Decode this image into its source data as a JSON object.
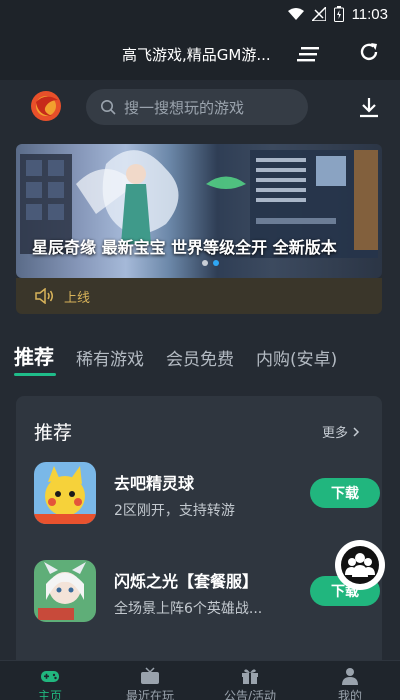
{
  "status_bar": {
    "time": "11:03"
  },
  "title_bar": {
    "title": "高飞游戏,精品GM游..."
  },
  "search": {
    "placeholder": "搜一搜想玩的游戏"
  },
  "banner": {
    "caption": "星辰奇缘 最新宝宝 世界等级全开 全新版本",
    "dot_count": 2,
    "active_dot": 2
  },
  "notice": {
    "text": "上线"
  },
  "tabs": [
    {
      "label": "推荐",
      "active": true
    },
    {
      "label": "稀有游戏",
      "active": false
    },
    {
      "label": "会员免费",
      "active": false
    },
    {
      "label": "内购(安卓)",
      "active": false
    }
  ],
  "card": {
    "title": "推荐",
    "more_label": "更多",
    "games": [
      {
        "name": "去吧精灵球",
        "desc": "2区刚开，支持转游",
        "button": "下载"
      },
      {
        "name": "闪烁之光【套餐服】",
        "desc": "全场景上阵6个英雄战...",
        "button": "下载"
      }
    ]
  },
  "bottom_nav": [
    {
      "label": "主页",
      "icon": "gamepad-icon",
      "active": true
    },
    {
      "label": "最近在玩",
      "icon": "tv-icon",
      "active": false
    },
    {
      "label": "公告/活动",
      "icon": "gift-icon",
      "active": false
    },
    {
      "label": "我的",
      "icon": "user-icon",
      "active": false
    }
  ],
  "colors": {
    "accent": "#21b67e",
    "notice": "#d8b35a",
    "background": "#252b33"
  }
}
